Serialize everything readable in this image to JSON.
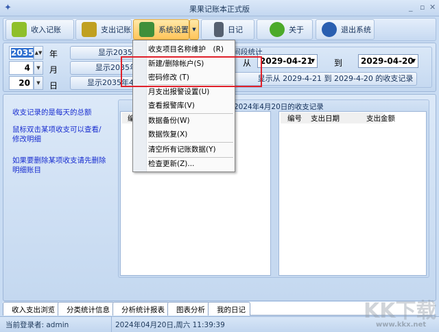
{
  "window": {
    "title": "果果记账本正式版"
  },
  "toolbar": {
    "items": [
      {
        "label": "收入记账",
        "icon": "folder-income-icon",
        "color": "#8fbf2a"
      },
      {
        "label": "支出记账",
        "icon": "folder-expense-icon",
        "color": "#c0a020"
      },
      {
        "label": "系统设置",
        "icon": "settings-tools-icon",
        "color": "#3f8f3a"
      },
      {
        "label": "日记",
        "icon": "diary-icon",
        "color": "#556070"
      },
      {
        "label": "关于",
        "icon": "gear-about-icon",
        "color": "#4caa2a"
      },
      {
        "label": "退出系统",
        "icon": "exit-icon",
        "color": "#2a5fb0"
      }
    ]
  },
  "date": {
    "year": "2035",
    "year_label": "年",
    "month": "4",
    "month_label": "月",
    "day": "20",
    "day_label": "日",
    "btn_year": "显示2035年的收支记录",
    "btn_month": "显示2035年4月的收支记录",
    "btn_day": "显示2035年4月20日的收支记录"
  },
  "range": {
    "group_title": "时间段统计",
    "from_label": "从",
    "from": "2029-04-21",
    "to_label": "到",
    "to": "2029-04-20",
    "button": "显示从 2029-4-21 到 2029-4-20 的收支记录"
  },
  "hints": [
    "收支记录的是每天的总额",
    "鼠标双击某项收支可以查看/修改明细",
    "如果要删除某项收支请先删除明细账目"
  ],
  "records": {
    "title": "2024年4月20日的收支记录",
    "left_columns": [
      "编号"
    ],
    "right_columns": [
      "编号",
      "支出日期",
      "支出金额"
    ]
  },
  "menu": {
    "items": [
      "收支项目名称维护　(R)",
      "新建/删除帐户(S)",
      "密码修改 (T)",
      "月支出报警设置(U)",
      "查看报警库(V)",
      "数据备份(W)",
      "数据恢复(X)",
      "清空所有记账数据(Y)",
      "检查更新(Z)..."
    ]
  },
  "tabs": [
    "收入支出浏览",
    "分类统计信息",
    "分析统计报表",
    "图表分析",
    "我的日记"
  ],
  "status": {
    "user": "当前登录者: admin",
    "datetime": "2024年04月20日,周六 11:39:39"
  },
  "watermark": {
    "text": "KK下载",
    "url": "www.kkx.net"
  }
}
